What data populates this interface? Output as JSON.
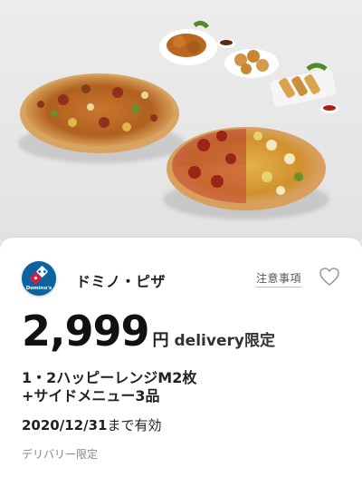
{
  "shop": {
    "name": "ドミノ・ピザ",
    "logo_text": "Domino's",
    "brand_blue": "#0b64a0",
    "brand_red": "#e31837"
  },
  "header": {
    "notes_link": "注意事項",
    "favorite_icon": "heart-outline-icon"
  },
  "offer": {
    "price": "2,999",
    "currency": "円",
    "condition": "delivery限定",
    "description_line1": "1・2ハッピーレンジM2枚",
    "description_line2": "+サイドメニュー3品",
    "expiry_date": "2020/12/31",
    "expiry_suffix": "まで有効",
    "footnote": "デリバリー限定"
  }
}
